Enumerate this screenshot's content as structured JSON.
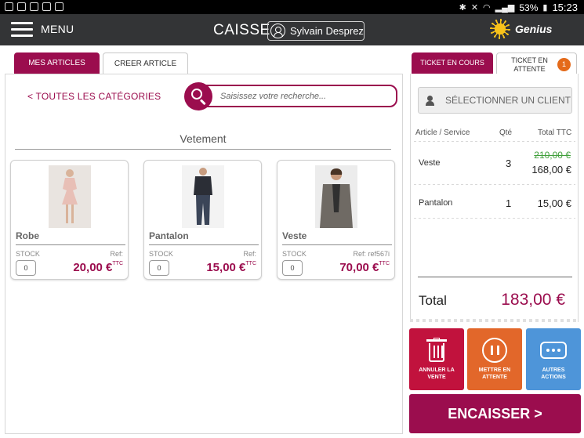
{
  "statusbar": {
    "battery": "53%",
    "time": "15:23"
  },
  "appbar": {
    "menu_label": "MENU",
    "title": "CAISSE",
    "user_name": "Sylvain Desprez",
    "brand": "Genius"
  },
  "left_tabs": {
    "mes_articles": "MES ARTICLES",
    "creer_article": "CREER ARTICLE"
  },
  "catalog": {
    "back_link": "< TOUTES LES CATÉGORIES",
    "search_placeholder": "Saisissez votre recherche...",
    "category_title": "Vetement",
    "products": [
      {
        "name": "Robe",
        "stock_label": "STOCK",
        "ref": "Ref:",
        "stock": "0",
        "price": "20,00 €",
        "tax": "TTC"
      },
      {
        "name": "Pantalon",
        "stock_label": "STOCK",
        "ref": "Ref:",
        "stock": "0",
        "price": "15,00 €",
        "tax": "TTC"
      },
      {
        "name": "Veste",
        "stock_label": "STOCK",
        "ref": "Ref: ref567i",
        "stock": "0",
        "price": "70,00 €",
        "tax": "TTC"
      }
    ]
  },
  "right_tabs": {
    "current": "TICKET EN COURS",
    "waiting_line1": "TICKET EN",
    "waiting_line2": "ATTENTE",
    "waiting_count": "1"
  },
  "ticket": {
    "select_client": "SÉLECTIONNER UN CLIENT",
    "col_article": "Article / Service",
    "col_qty": "Qté",
    "col_total": "Total TTC",
    "lines": [
      {
        "name": "Veste",
        "qty": "3",
        "old_total": "210,00 €",
        "total": "168,00 €"
      },
      {
        "name": "Pantalon",
        "qty": "1",
        "total": "15,00 €"
      }
    ],
    "total_label": "Total",
    "total_value": "183,00 €"
  },
  "actions": {
    "cancel_line1": "ANNULER LA",
    "cancel_line2": "VENTE",
    "hold_line1": "METTRE EN",
    "hold_line2": "ATTENTE",
    "other_line1": "AUTRES",
    "other_line2": "ACTIONS",
    "pay": "ENCAISSER >"
  },
  "colors": {
    "accent": "#9b0d4e",
    "orange": "#e2672a",
    "red": "#c1123d",
    "blue": "#4e95d9",
    "appbar": "#333436"
  }
}
